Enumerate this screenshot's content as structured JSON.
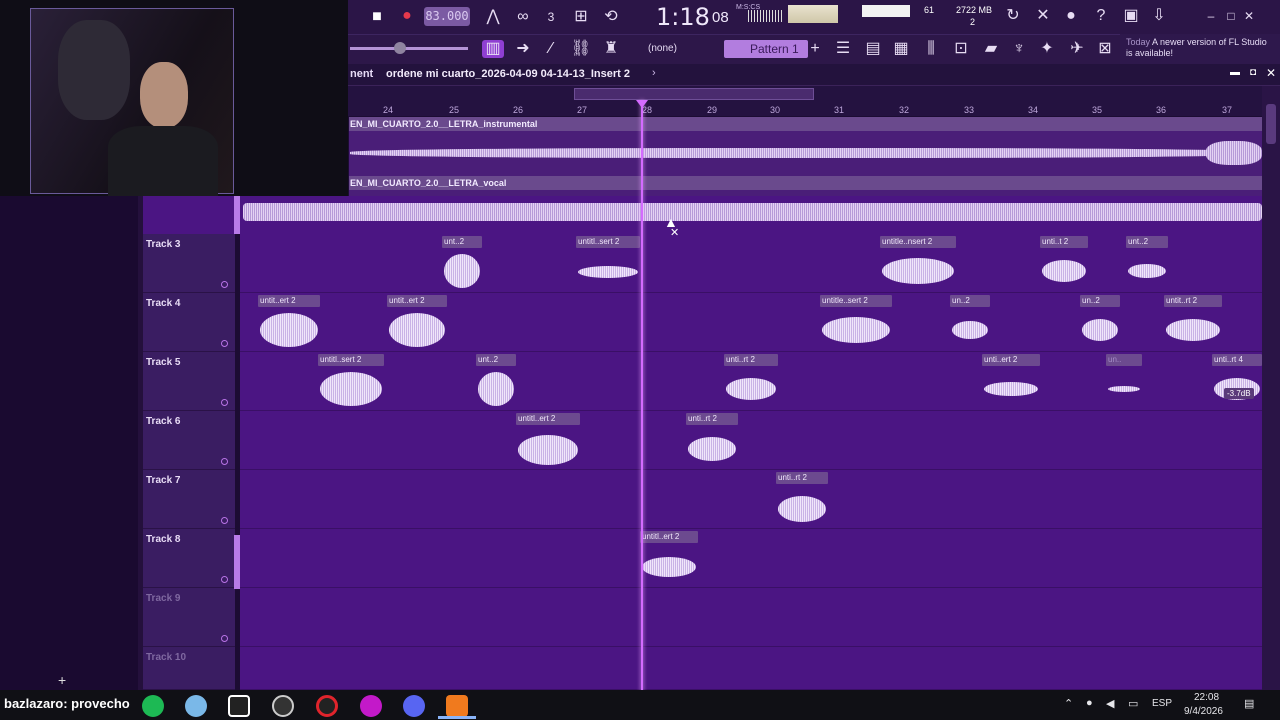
{
  "toolbar": {
    "tempo": "83.000",
    "time_main": "1:18",
    "time_sub": "08",
    "time_unit": "M:S:CS",
    "cpu_value": "61",
    "memory": "2722 MB",
    "voices": "2",
    "pattern_label": "Pattern 1",
    "pattern_none": "(none)",
    "hint_prefix": "Today",
    "hint_text": "A newer version of FL Studio is available!"
  },
  "window": {
    "title_prefix": "nent",
    "title": "ordene mi cuarto_2026-04-09 04-14-13_Insert 2"
  },
  "ruler": {
    "marks": [
      "24",
      "25",
      "26",
      "27",
      "28",
      "29",
      "30",
      "31",
      "32",
      "33",
      "34",
      "35",
      "36",
      "37"
    ]
  },
  "audio_tracks": [
    {
      "name": "EN_MI_CUARTO_2.0__LETRA_instrumental"
    },
    {
      "name": "EN_MI_CUARTO_2.0__LETRA_vocal"
    }
  ],
  "tracks": [
    {
      "label": "Track 3",
      "clips": [
        "untit..ert 2",
        "unt..2",
        "untitl..sert 2",
        "untitle..nsert 2",
        "unti..t 2",
        "unt..2"
      ]
    },
    {
      "label": "Track 4",
      "clips": [
        "untit..ert 2",
        "untit..ert 2",
        "untitle..sert 2",
        "un..2",
        "un..2",
        "untit..rt 2"
      ]
    },
    {
      "label": "Track 5",
      "clips": [
        "untitl..sert 2",
        "unt..2",
        "unti..rt 2",
        "unti..ert 2",
        "un..",
        "unti..rt 4"
      ]
    },
    {
      "label": "Track 6",
      "clips": [
        "untitl..ert 2",
        "unti..rt 2"
      ]
    },
    {
      "label": "Track 7",
      "clips": [
        "unti..rt 2"
      ]
    },
    {
      "label": "Track 8",
      "clips": [
        "untitl..ert 2"
      ]
    },
    {
      "label": "Track 9",
      "clips": []
    },
    {
      "label": "Track 10",
      "clips": []
    }
  ],
  "db_tag": "-3.7dB",
  "taskbar": {
    "ticker": "bazlazaro: provecho",
    "lang": "ESP",
    "time": "22:08",
    "date": "9/4/2026"
  },
  "colors": {
    "lane": "#4b1583",
    "playhead": "#d46bff",
    "clip_label": "#6c4a8f"
  }
}
